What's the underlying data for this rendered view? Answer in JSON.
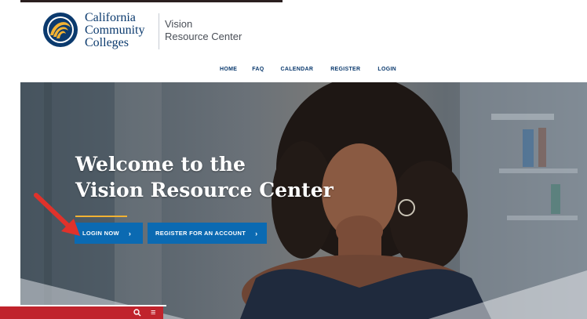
{
  "logo": {
    "line1": "California",
    "line2": "Community",
    "line3": "Colleges",
    "sub1": "Vision",
    "sub2": "Resource Center"
  },
  "nav": {
    "home": "HOME",
    "faq": "FAQ",
    "calendar": "CALENDAR",
    "register": "REGISTER",
    "login": "LOGIN"
  },
  "hero": {
    "title_line1": "Welcome to the",
    "title_line2": "Vision Resource Center",
    "login_button": "LOGIN NOW",
    "register_button": "REGISTER FOR AN ACCOUNT"
  },
  "icons": {
    "chevron": "chevron-right-icon",
    "search": "search-icon",
    "menu": "menu-icon",
    "arrow": "red-arrow-icon"
  },
  "colors": {
    "brand_blue": "#0b3a6e",
    "button_blue": "#0b6ab2",
    "accent_gold": "#f2b233",
    "bar_red": "#c0232c"
  }
}
